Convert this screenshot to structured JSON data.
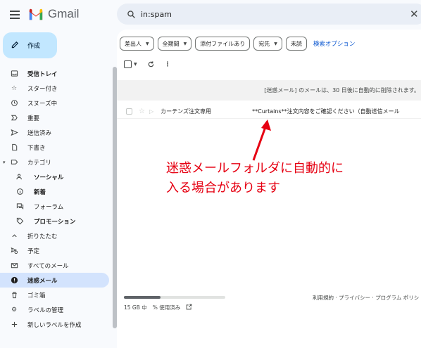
{
  "app": {
    "name": "Gmail"
  },
  "search": {
    "value": "in:spam"
  },
  "sidebar": {
    "compose_label": "作成",
    "items": [
      {
        "label": "受信トレイ",
        "icon": "inbox-icon",
        "bold": true
      },
      {
        "label": "スター付き",
        "icon": "star-icon"
      },
      {
        "label": "スヌーズ中",
        "icon": "clock-icon"
      },
      {
        "label": "重要",
        "icon": "important-icon"
      },
      {
        "label": "送信済み",
        "icon": "send-icon"
      },
      {
        "label": "下書き",
        "icon": "draft-icon"
      },
      {
        "label": "カテゴリ",
        "icon": "label-icon"
      },
      {
        "label": "ソーシャル",
        "icon": "people-icon",
        "bold": true
      },
      {
        "label": "新着",
        "icon": "info-icon",
        "bold": true
      },
      {
        "label": "フォーラム",
        "icon": "forum-icon"
      },
      {
        "label": "プロモーション",
        "icon": "tag-icon",
        "bold": true
      },
      {
        "label": "折りたたむ",
        "icon": "chevron-up-icon"
      },
      {
        "label": "予定",
        "icon": "scheduled-icon"
      },
      {
        "label": "すべてのメール",
        "icon": "all-mail-icon"
      },
      {
        "label": "迷惑メール",
        "icon": "spam-icon",
        "active": true
      },
      {
        "label": "ゴミ箱",
        "icon": "trash-icon"
      },
      {
        "label": "ラベルの管理",
        "icon": "gear-icon"
      },
      {
        "label": "新しいラベルを作成",
        "icon": "plus-icon"
      }
    ]
  },
  "filters": {
    "from": "差出人",
    "any_time": "全期間",
    "has_attachment": "添付ファイルあり",
    "to": "宛先",
    "unread": "未読",
    "advanced": "検索オプション"
  },
  "banner": {
    "text": "[迷惑メール] のメールは、30 日後に自動的に削除されます。"
  },
  "message": {
    "sender": "カーテンズ注文専用",
    "subject": "**Curtains**注文内容をご確認ください（自動送信メール"
  },
  "annotation": {
    "line1": "迷惑メールフォルダに自動的に",
    "line2": "入る場合があります",
    "color": "#e60012"
  },
  "storage": {
    "used": "15 GB 中",
    "percent": "% 使用済み",
    "fraction": 0.36
  },
  "footer": {
    "links": "利用規約 · プライバシー · プログラム ポリシ"
  }
}
